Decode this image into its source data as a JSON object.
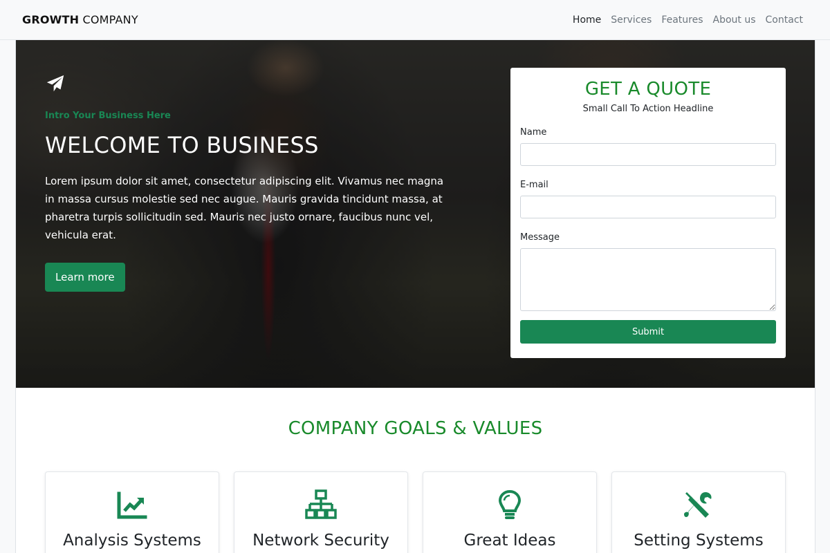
{
  "brand": {
    "bold": "GROWTH",
    "light": "COMPANY"
  },
  "nav": {
    "items": [
      "Home",
      "Services",
      "Features",
      "About us",
      "Contact"
    ]
  },
  "hero": {
    "intro": "Intro Your Business Here",
    "title": "WELCOME TO BUSINESS",
    "text": "Lorem ipsum dolor sit amet, consectetur adipiscing elit. Vivamus nec magna in massa cursus molestie sed nec augue. Mauris gravida tincidunt massa, at pharetra turpis sollicitudin sed. Mauris nec justo ornare, faucibus nunc vel, vehicula erat.",
    "button": "Learn more",
    "icon": "paper-plane-icon"
  },
  "quote": {
    "title": "GET A QUOTE",
    "subtitle": "Small Call To Action Headline",
    "name_label": "Name",
    "name_value": "",
    "email_label": "E-mail",
    "email_value": "",
    "message_label": "Message",
    "message_value": "",
    "submit": "Submit"
  },
  "goals": {
    "title": "COMPANY GOALS & VALUES",
    "cards": [
      {
        "title": "Analysis Systems",
        "icon": "chart-line-icon"
      },
      {
        "title": "Network Security",
        "icon": "network-icon"
      },
      {
        "title": "Great Ideas",
        "icon": "lightbulb-icon"
      },
      {
        "title": "Setting Systems",
        "icon": "tools-icon"
      }
    ]
  },
  "colors": {
    "accent": "#198754",
    "heading_green": "#198a2b"
  }
}
